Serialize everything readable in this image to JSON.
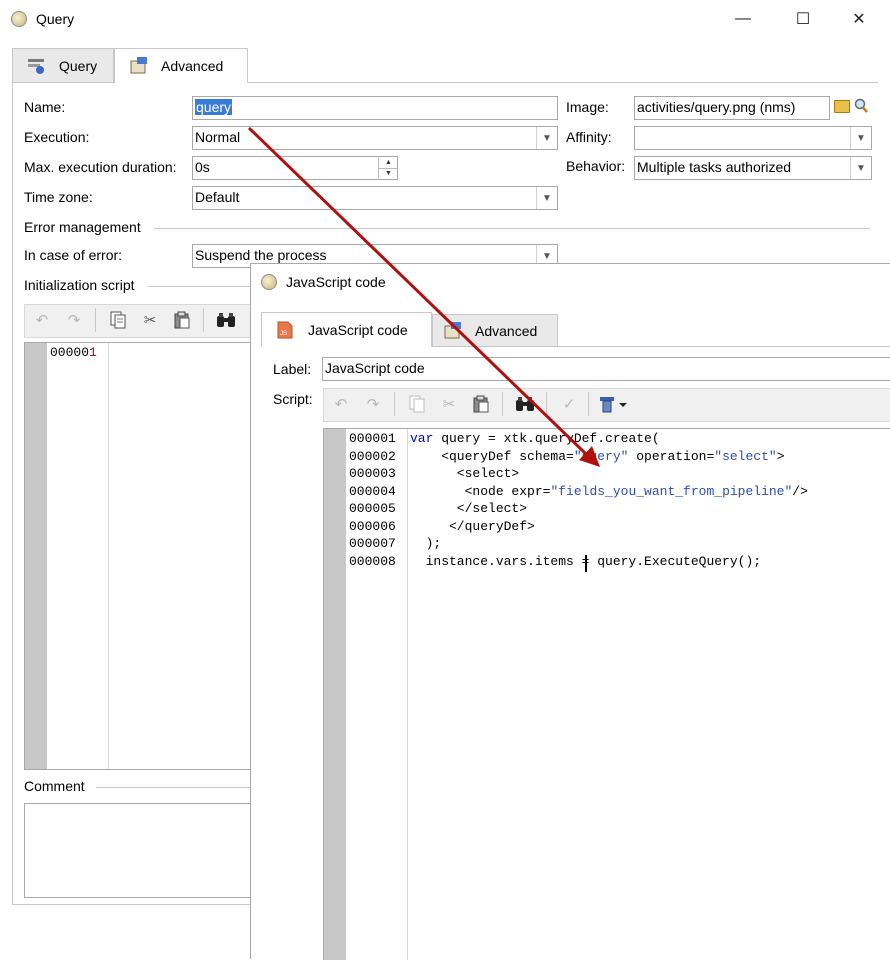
{
  "query_window": {
    "title": "Query",
    "controls": {
      "minimize": "—",
      "maximize": "☐",
      "close": "✕"
    },
    "tabs": [
      {
        "label": "Query"
      },
      {
        "label": "Advanced"
      }
    ],
    "fields": {
      "name_label": "Name:",
      "name_value": "query",
      "execution_label": "Execution:",
      "execution_value": "Normal",
      "max_duration_label": "Max. execution duration:",
      "max_duration_value": "0s",
      "time_zone_label": "Time zone:",
      "time_zone_value": "Default",
      "image_label": "Image:",
      "image_value": "activities/query.png (nms)",
      "affinity_label": "Affinity:",
      "affinity_value": "",
      "behavior_label": "Behavior:",
      "behavior_value": "Multiple tasks authorized"
    },
    "error_management": {
      "heading": "Error management",
      "in_case_label": "In case of error:",
      "in_case_value": "Suspend the process"
    },
    "init_script": {
      "heading": "Initialization script",
      "line_number": "00000",
      "line_number_last": "1"
    },
    "comment": {
      "heading": "Comment"
    }
  },
  "js_window": {
    "title": "JavaScript code",
    "tabs": [
      {
        "label": "JavaScript code"
      },
      {
        "label": "Advanced"
      }
    ],
    "label_field": {
      "label": "Label:",
      "value": "JavaScript code"
    },
    "script_label": "Script:",
    "code_lines": [
      {
        "num": "000001",
        "code": [
          {
            "t": "var",
            "c": "kw"
          },
          {
            "t": " query = xtk.queryDef.create(",
            "c": ""
          }
        ]
      },
      {
        "num": "000002",
        "code": [
          {
            "t": "    <queryDef schema=",
            "c": ""
          },
          {
            "t": "\"query\"",
            "c": "str"
          },
          {
            "t": " operation=",
            "c": ""
          },
          {
            "t": "\"select\"",
            "c": "str"
          },
          {
            "t": ">",
            "c": ""
          }
        ]
      },
      {
        "num": "000003",
        "code": [
          {
            "t": "      <select>",
            "c": ""
          }
        ]
      },
      {
        "num": "000004",
        "code": [
          {
            "t": "       <node expr=",
            "c": ""
          },
          {
            "t": "\"fields_you_want_from_pipeline\"",
            "c": "str"
          },
          {
            "t": "/>",
            "c": ""
          }
        ]
      },
      {
        "num": "000005",
        "code": [
          {
            "t": "      </select>",
            "c": ""
          }
        ]
      },
      {
        "num": "000006",
        "code": [
          {
            "t": "     </queryDef>",
            "c": ""
          }
        ]
      },
      {
        "num": "000007",
        "code": [
          {
            "t": "  );",
            "c": ""
          }
        ]
      },
      {
        "num": "000008",
        "code": [
          {
            "t": "  instance.vars.items = query.ExecuteQuery();",
            "c": ""
          }
        ]
      }
    ]
  },
  "colors": {
    "arrow": "#b01010",
    "selection": "#3a7bd5",
    "gutter": "#c8c8c8",
    "keyword": "#0000cc",
    "string": "#2d4db8"
  }
}
